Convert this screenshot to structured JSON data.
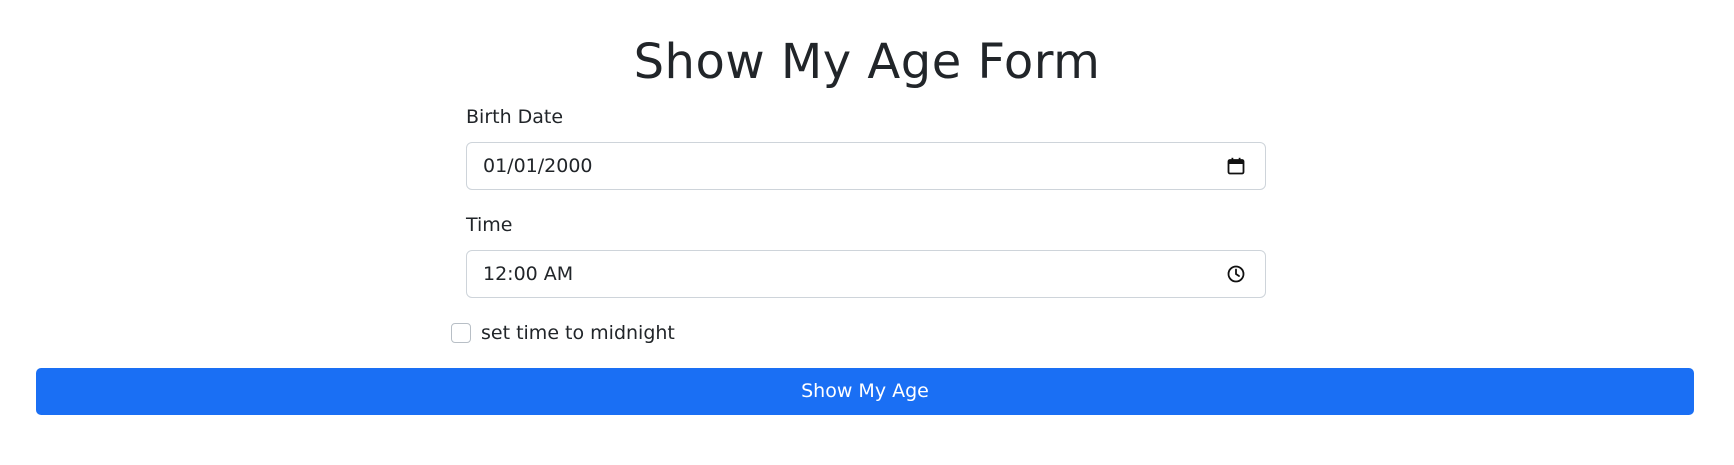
{
  "page": {
    "title": "Show My Age Form"
  },
  "form": {
    "birth_date": {
      "label": "Birth Date",
      "value": "01/01/2000",
      "icon": "calendar-icon"
    },
    "time": {
      "label": "Time",
      "value": "12:00 AM",
      "icon": "clock-icon"
    },
    "midnight_checkbox": {
      "label": "set time to midnight",
      "checked": false
    },
    "submit": {
      "label": "Show My Age"
    }
  },
  "colors": {
    "primary": "#1a6ff4",
    "text": "#212529",
    "border": "#ced4da"
  }
}
